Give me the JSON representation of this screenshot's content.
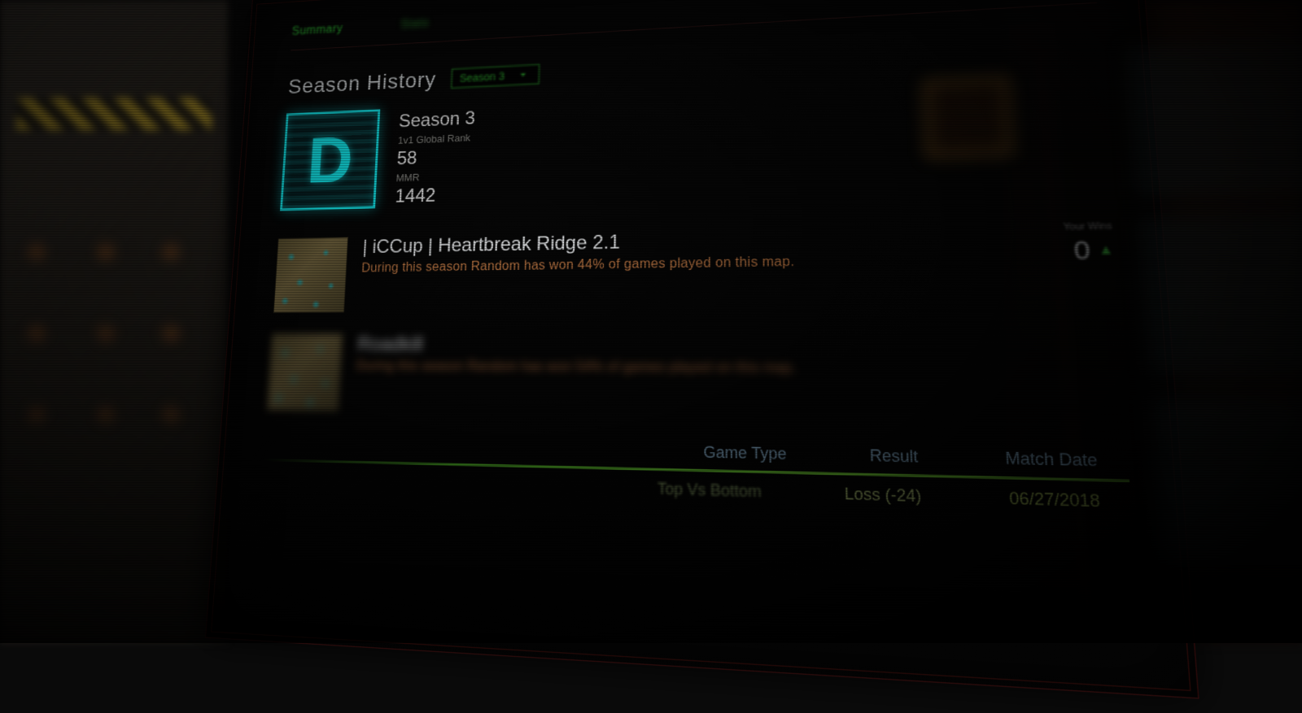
{
  "tabs": {
    "summary": "Summary",
    "season_selector_label": "Season 3"
  },
  "section": {
    "title": "Season History"
  },
  "rank": {
    "letter": "D",
    "season_label": "Season 3",
    "global_rank_label": "1v1 Global Rank",
    "global_rank_value": "58",
    "mmr_label": "MMR",
    "mmr_value": "1442"
  },
  "maps": [
    {
      "name": "| iCCup | Heartbreak Ridge 2.1",
      "desc": "During this season Random has won 44% of games played on this map.",
      "side_label": "Your Wins",
      "side_value": "0"
    },
    {
      "name": "Roadkill",
      "desc": "During this season Random has won 54% of games played on this map."
    }
  ],
  "table": {
    "headers": {
      "game_type": "Game Type",
      "result": "Result",
      "match_date": "Match Date"
    },
    "rows": [
      {
        "game_type": "Top Vs Bottom",
        "result": "Loss (-24)",
        "match_date": "06/27/2018"
      }
    ]
  },
  "colors": {
    "cyan": "#14e2e6",
    "green": "#35d63a",
    "orange_text": "#c77d47",
    "header_blue": "#7fa4bf"
  }
}
